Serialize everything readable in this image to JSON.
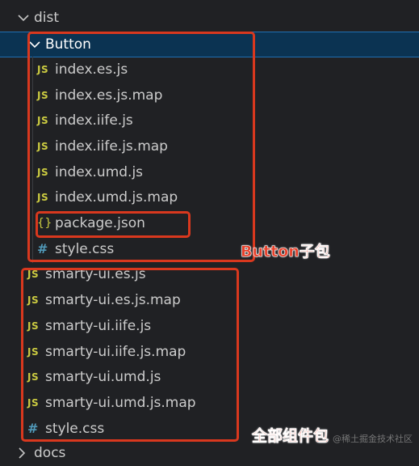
{
  "explorer": {
    "dist_folder": "dist",
    "button_folder": "Button",
    "button_files": [
      {
        "icon": "JS",
        "name": "index.es.js"
      },
      {
        "icon": "JS",
        "name": "index.es.js.map"
      },
      {
        "icon": "JS",
        "name": "index.iife.js"
      },
      {
        "icon": "JS",
        "name": "index.iife.js.map"
      },
      {
        "icon": "JS",
        "name": "index.umd.js"
      },
      {
        "icon": "JS",
        "name": "index.umd.js.map"
      },
      {
        "icon": "{}",
        "name": "package.json"
      },
      {
        "icon": "#",
        "name": "style.css"
      }
    ],
    "dist_files": [
      {
        "icon": "JS",
        "name": "smarty-ui.es.js"
      },
      {
        "icon": "JS",
        "name": "smarty-ui.es.js.map"
      },
      {
        "icon": "JS",
        "name": "smarty-ui.iife.js"
      },
      {
        "icon": "JS",
        "name": "smarty-ui.iife.js.map"
      },
      {
        "icon": "JS",
        "name": "smarty-ui.umd.js"
      },
      {
        "icon": "JS",
        "name": "smarty-ui.umd.js.map"
      },
      {
        "icon": "#",
        "name": "style.css"
      }
    ],
    "docs_folder": "docs"
  },
  "annotations": {
    "button_subpackage": "Button子包",
    "full_package": "全部组件包"
  },
  "watermark": "@稀土掘金技术社区",
  "colors": {
    "background": "#202124",
    "selected_row": "#0b3352",
    "js_icon": "#cbcb41",
    "css_icon": "#519aba",
    "annotation_red": "#d9381e"
  }
}
